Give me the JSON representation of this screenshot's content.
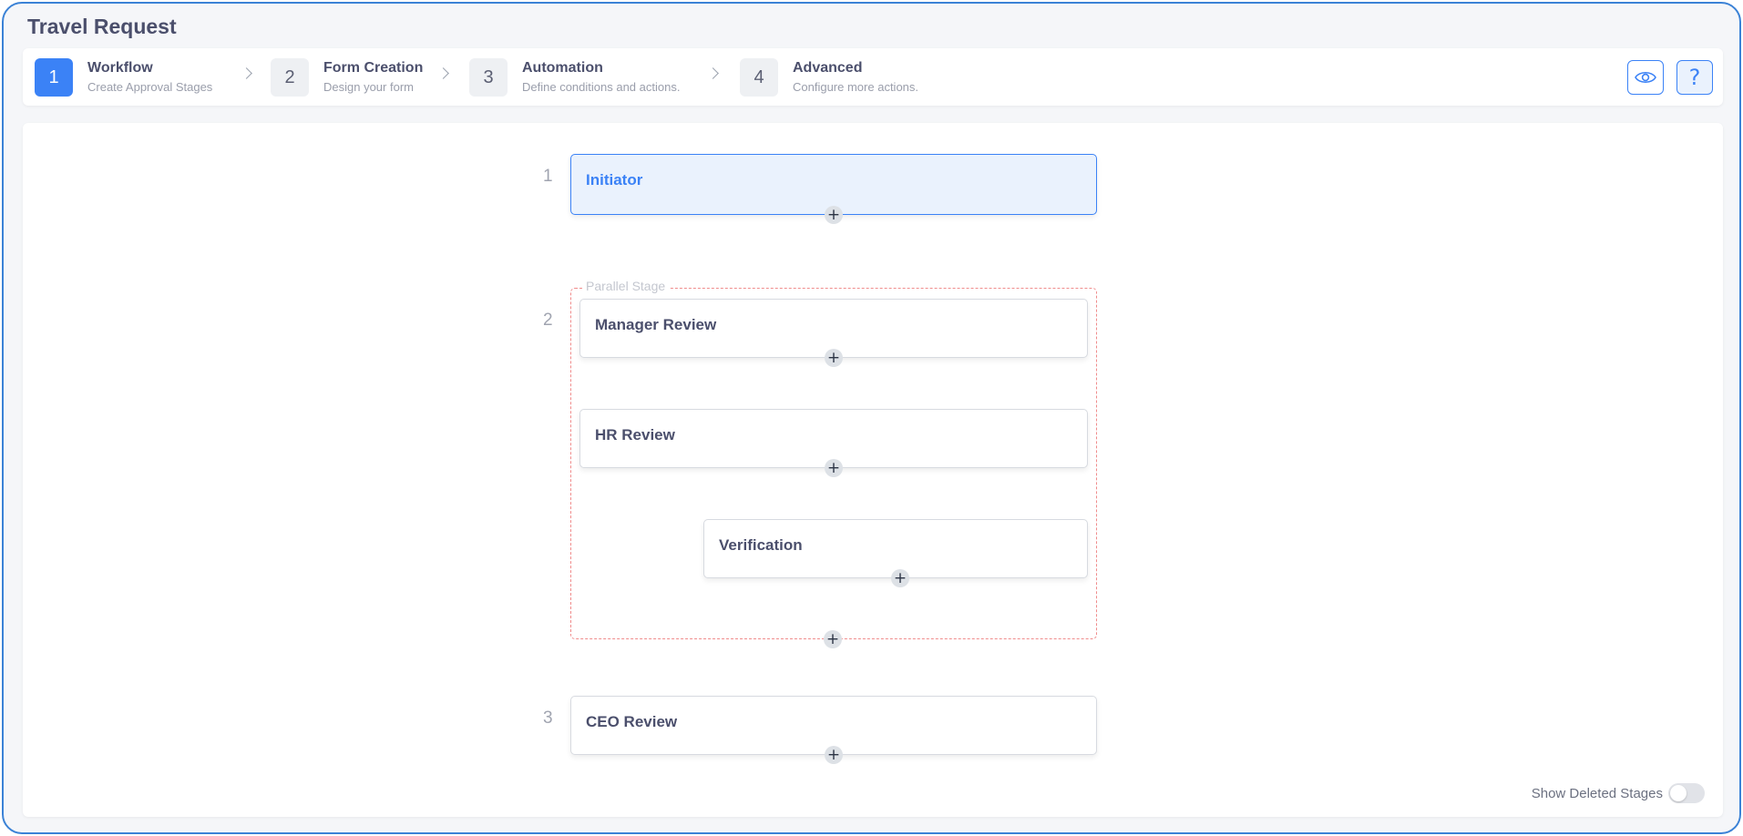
{
  "page": {
    "title": "Travel Request"
  },
  "stepper": {
    "steps": [
      {
        "number": "1",
        "title": "Workflow",
        "subtitle": "Create Approval Stages",
        "active": true
      },
      {
        "number": "2",
        "title": "Form Creation",
        "subtitle": "Design your form",
        "active": false
      },
      {
        "number": "3",
        "title": "Automation",
        "subtitle": "Define conditions and actions.",
        "active": false
      },
      {
        "number": "4",
        "title": "Advanced",
        "subtitle": "Configure more actions.",
        "active": false
      }
    ],
    "preview_icon": "eye-icon",
    "help_icon": "question-mark-icon"
  },
  "workflow": {
    "stages": [
      {
        "number": "1",
        "cards": [
          {
            "title": "Initiator"
          }
        ]
      },
      {
        "number": "2",
        "label": "Parallel Stage",
        "cards": [
          {
            "title": "Manager Review"
          },
          {
            "title": "HR Review"
          },
          {
            "title": "Verification"
          }
        ]
      },
      {
        "number": "3",
        "cards": [
          {
            "title": "CEO Review"
          }
        ]
      }
    ],
    "add_glyph": "+"
  },
  "footer": {
    "show_deleted_label": "Show Deleted Stages",
    "show_deleted_enabled": false
  },
  "colors": {
    "accent": "#3b82f6",
    "parallel_border": "#f08c8c",
    "frame_border": "#3b82d6"
  }
}
